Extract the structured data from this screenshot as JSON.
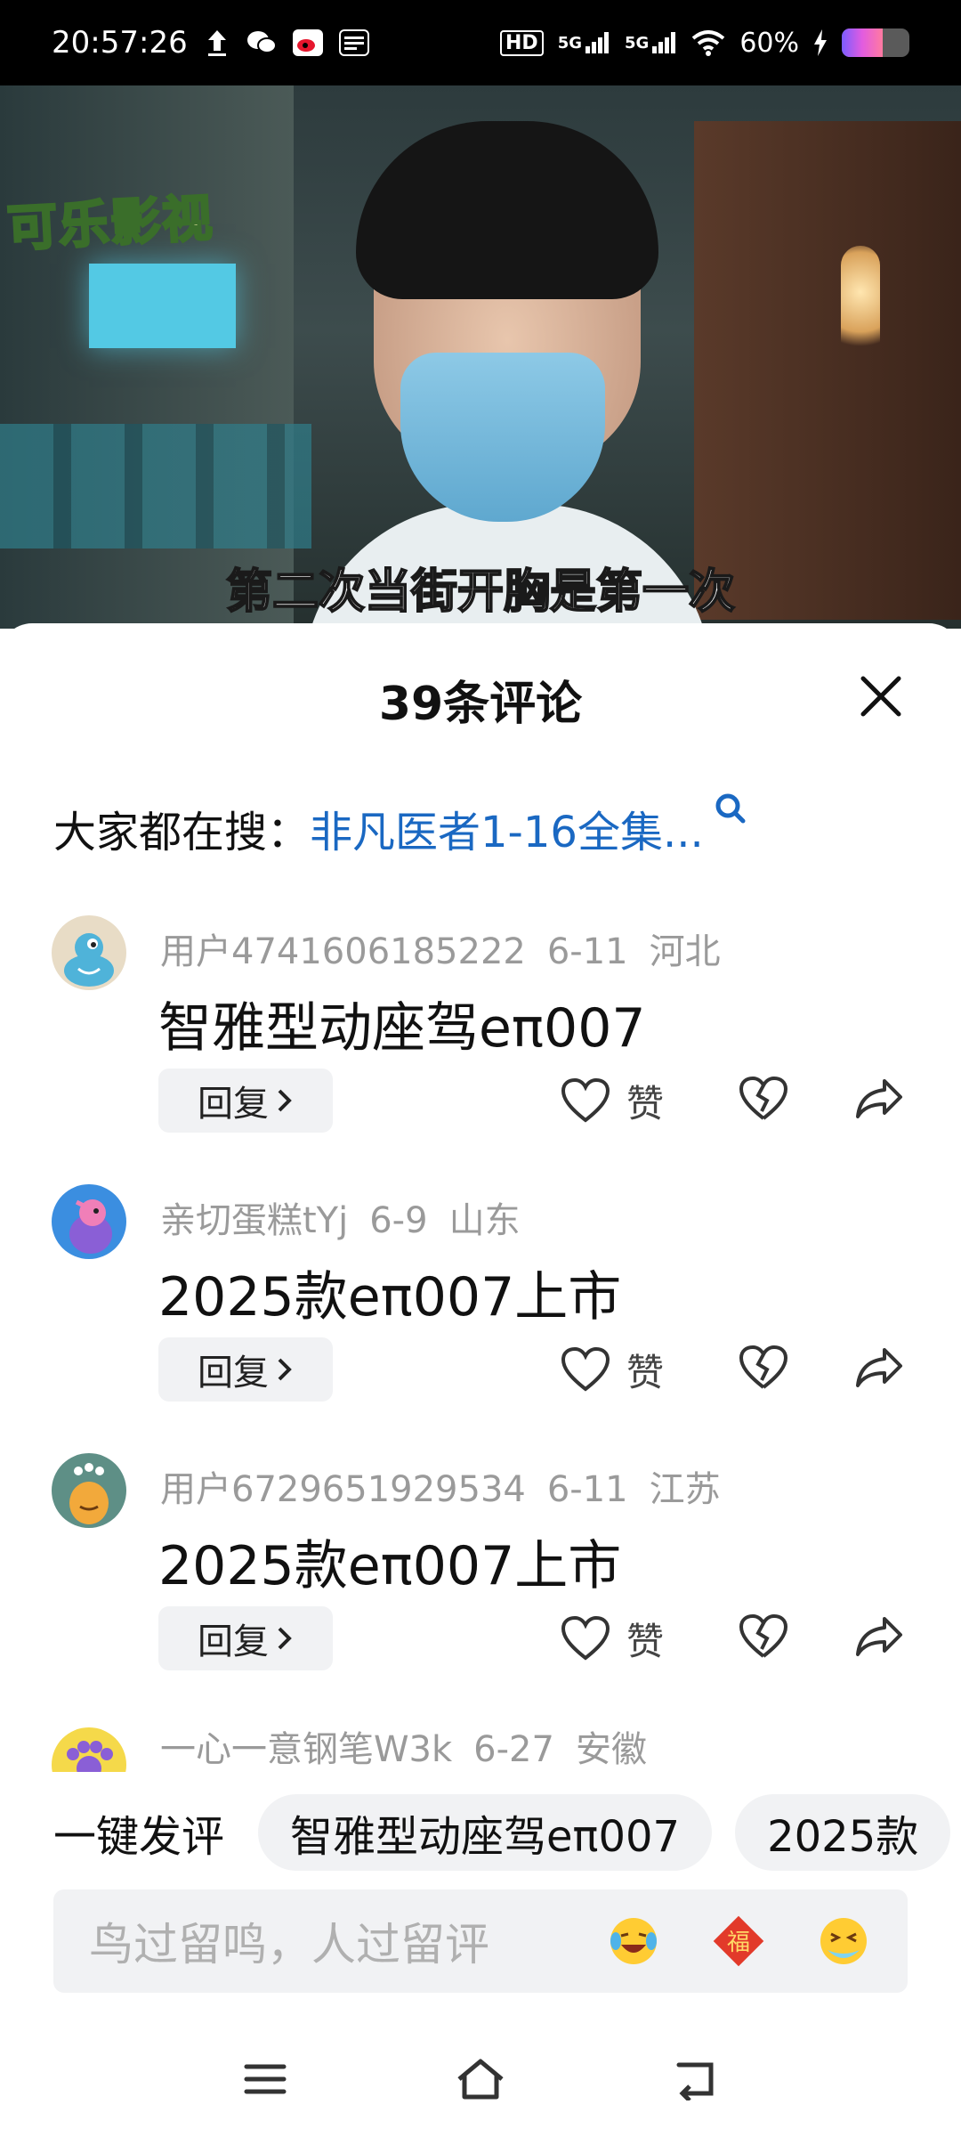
{
  "status_bar": {
    "time": "20:57:26",
    "battery_text": "60%",
    "battery_level": 0.6,
    "network_labels": [
      "5G",
      "5G"
    ],
    "hd_label": "HD"
  },
  "video": {
    "watermark": "可乐影视",
    "subtitle": "第二次当街开胸是第一次"
  },
  "comments_panel": {
    "title": "39条评论",
    "search_prefix": "大家都在搜：",
    "search_term": "非凡医者1-16全集..."
  },
  "comments": [
    {
      "user": "用户4741606185222",
      "date": "6-11",
      "location": "河北",
      "text": "智雅型动座驾eπ007",
      "reply_label": "回复",
      "like_label": "赞",
      "avatar_icon": "blue-monster-avatar",
      "avatar_color": "#e8dcc6"
    },
    {
      "user": "亲切蛋糕tYj",
      "date": "6-9",
      "location": "山东",
      "text": "2025款eπ007上市",
      "reply_label": "回复",
      "like_label": "赞",
      "avatar_icon": "pink-creature-avatar",
      "avatar_color": "#3b8ee0"
    },
    {
      "user": "用户6729651929534",
      "date": "6-11",
      "location": "江苏",
      "text": "2025款eπ007上市",
      "reply_label": "回复",
      "like_label": "赞",
      "avatar_icon": "orange-monster-avatar",
      "avatar_color": "#5e8f86"
    }
  ],
  "partial_comment": {
    "user": "一心一意钢笔W3k",
    "date": "6-27",
    "location": "安徽",
    "avatar_icon": "paw-avatar",
    "avatar_color": "#f5d94a"
  },
  "quick_comment": {
    "label": "一键发评",
    "chips": [
      "智雅型动座驾eπ007",
      "2025款"
    ]
  },
  "input": {
    "placeholder": "鸟过留鸣，人过留评",
    "emoji_icons": [
      "laughing-cry-emoji",
      "fu-blessing-emoji",
      "sneeze-emoji"
    ],
    "fu_char": "福"
  },
  "colors": {
    "link_blue": "#1a68c2",
    "chip_bg": "#f1f2f4",
    "meta_gray": "#9a9a9a"
  }
}
